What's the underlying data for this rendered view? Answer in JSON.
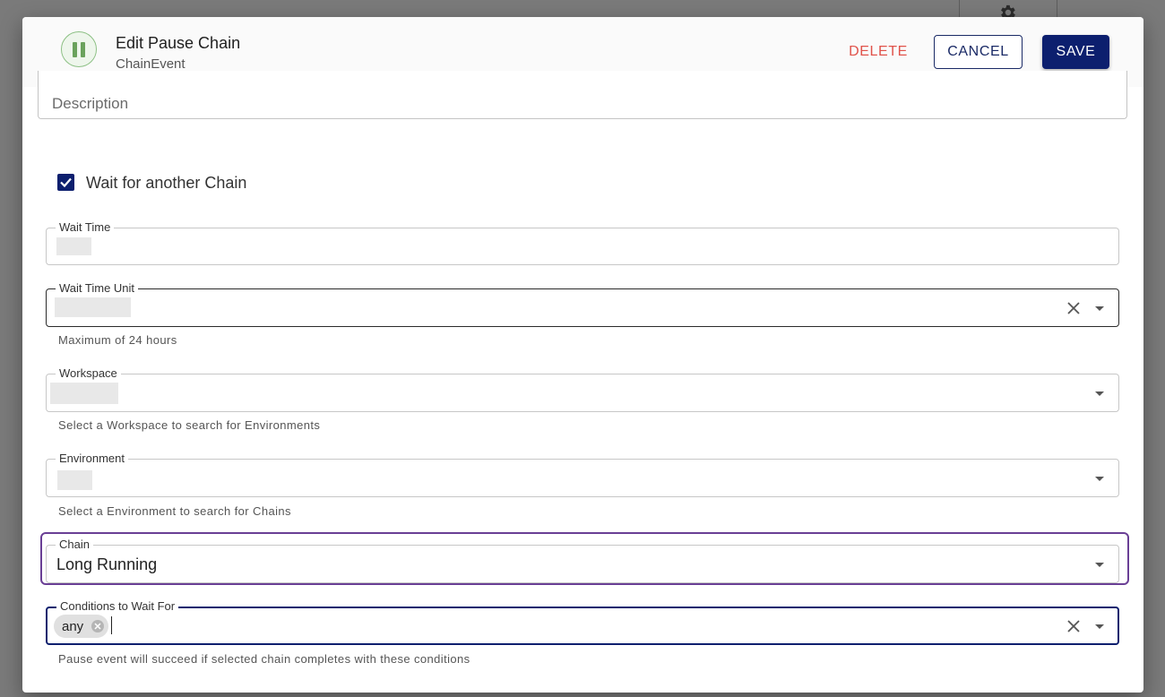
{
  "dialog": {
    "title": "Edit Pause Chain",
    "subtitle": "ChainEvent",
    "actions": {
      "delete_label": "DELETE",
      "cancel_label": "CANCEL",
      "save_label": "SAVE"
    },
    "icon": "pause-icon"
  },
  "form": {
    "description_label": "Description",
    "wait_for_another_chain": {
      "label": "Wait for another Chain",
      "checked": true
    },
    "wait_time": {
      "label": "Wait Time",
      "value": ""
    },
    "wait_time_unit": {
      "label": "Wait Time Unit",
      "value": "",
      "helper": "Maximum of 24 hours"
    },
    "workspace": {
      "label": "Workspace",
      "value": "",
      "helper": "Select a Workspace to search for Environments"
    },
    "environment": {
      "label": "Environment",
      "value": "",
      "helper": "Select a Environment to search for Chains"
    },
    "chain": {
      "label": "Chain",
      "value": "Long Running"
    },
    "conditions": {
      "label": "Conditions to Wait For",
      "chips": [
        "any"
      ],
      "helper": "Pause event will succeed if selected chain completes with these conditions"
    }
  },
  "colors": {
    "primary": "#0c1f6e",
    "delete": "#e0524a",
    "highlight": "#6a3f95",
    "pause_icon": "#6aa25c"
  }
}
